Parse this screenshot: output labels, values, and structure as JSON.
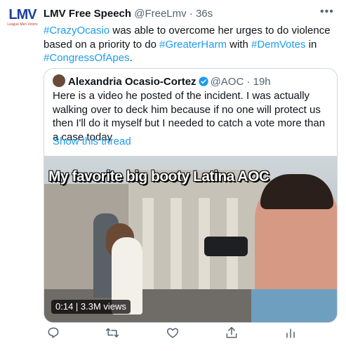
{
  "tweet": {
    "avatar_text": "LMV",
    "avatar_sub": "League Men Voters",
    "author_name": "LMV Free Speech",
    "author_handle": "@FreeLmv · 36s",
    "body": {
      "tag1": "#CrazyOcasio",
      "text1": " was able to overcome her urges to do violence based on a priority to do ",
      "tag2": "#GreaterHarm",
      "text2": " with ",
      "tag3": "#DemVotes",
      "text3": " in ",
      "tag4": "#CongressOfApes",
      "text4": "."
    }
  },
  "quote": {
    "author_name": "Alexandria Ocasio-Cortez",
    "author_handle": "@AOC · 19h",
    "text": "Here is a video he posted of the incident. I was actually walking over to deck him because if no one will protect us then I'll do it myself but I needed to catch a vote more than a case today",
    "show_thread": "Show this thread",
    "video": {
      "overlay": "My favorite big booty Latina AOC",
      "badge": "0:14 | 3.3M views"
    }
  },
  "icons": {
    "more": "more-horizontal-icon",
    "verified": "verified-badge-icon",
    "reply": "reply-icon",
    "retweet": "retweet-icon",
    "like": "like-icon",
    "share": "share-icon",
    "analytics": "analytics-icon"
  },
  "colors": {
    "link": "#1d9bf0",
    "text": "#0f1419",
    "muted": "#536471",
    "border": "#cfd9de"
  }
}
